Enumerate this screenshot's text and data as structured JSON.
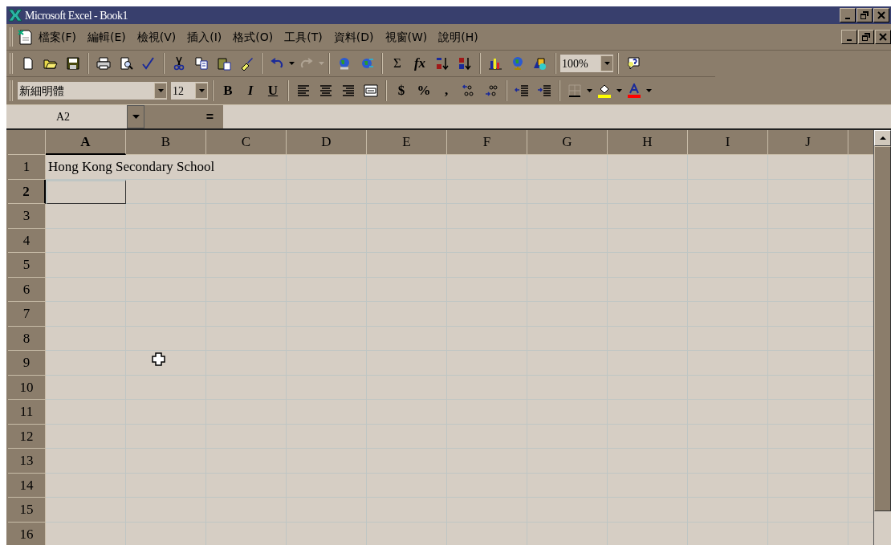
{
  "window": {
    "title": "Microsoft Excel - Book1"
  },
  "menu": [
    "檔案(F)",
    "編輯(E)",
    "檢視(V)",
    "插入(I)",
    "格式(O)",
    "工具(T)",
    "資料(D)",
    "視窗(W)",
    "說明(H)"
  ],
  "standard_toolbar": {
    "undo": {
      "disabled": false
    },
    "redo": {
      "disabled": true
    },
    "sum": "Σ",
    "function": "fx",
    "zoom": "100%"
  },
  "formatting_toolbar": {
    "font": "新細明體",
    "size": "12",
    "bold": "B",
    "italic": "I",
    "underline": "U",
    "currency": "$",
    "percent": "%",
    "comma": ","
  },
  "formula_bar": {
    "name_box": "A2",
    "equals": "="
  },
  "sheet": {
    "columns": [
      {
        "label": "A",
        "selected": true
      },
      {
        "label": "B",
        "selected": false
      },
      {
        "label": "C",
        "selected": false
      },
      {
        "label": "D",
        "selected": false
      },
      {
        "label": "E",
        "selected": false
      },
      {
        "label": "F",
        "selected": false
      },
      {
        "label": "G",
        "selected": false
      },
      {
        "label": "H",
        "selected": false
      },
      {
        "label": "I",
        "selected": false
      },
      {
        "label": "J",
        "selected": false
      }
    ],
    "rows": [
      {
        "label": "1",
        "selected": false,
        "cells": [
          {
            "text": "Hong Kong Secondary School",
            "selected": false
          },
          {
            "selected": false
          },
          {
            "selected": false
          },
          {
            "selected": false
          },
          {
            "selected": false
          },
          {
            "selected": false
          },
          {
            "selected": false
          },
          {
            "selected": false
          },
          {
            "selected": false
          },
          {
            "selected": false
          }
        ]
      },
      {
        "label": "2",
        "selected": true,
        "cells": [
          {
            "selected": true
          },
          {
            "selected": false
          },
          {
            "selected": false
          },
          {
            "selected": false
          },
          {
            "selected": false
          },
          {
            "selected": false
          },
          {
            "selected": false
          },
          {
            "selected": false
          },
          {
            "selected": false
          },
          {
            "selected": false
          }
        ]
      },
      {
        "label": "3",
        "selected": false,
        "cells": [
          {
            "selected": false
          },
          {
            "selected": false
          },
          {
            "selected": false
          },
          {
            "selected": false
          },
          {
            "selected": false
          },
          {
            "selected": false
          },
          {
            "selected": false
          },
          {
            "selected": false
          },
          {
            "selected": false
          },
          {
            "selected": false
          }
        ]
      },
      {
        "label": "4",
        "selected": false,
        "cells": [
          {
            "selected": false
          },
          {
            "selected": false
          },
          {
            "selected": false
          },
          {
            "selected": false
          },
          {
            "selected": false
          },
          {
            "selected": false
          },
          {
            "selected": false
          },
          {
            "selected": false
          },
          {
            "selected": false
          },
          {
            "selected": false
          }
        ]
      },
      {
        "label": "5",
        "selected": false,
        "cells": [
          {
            "selected": false
          },
          {
            "selected": false
          },
          {
            "selected": false
          },
          {
            "selected": false
          },
          {
            "selected": false
          },
          {
            "selected": false
          },
          {
            "selected": false
          },
          {
            "selected": false
          },
          {
            "selected": false
          },
          {
            "selected": false
          }
        ]
      },
      {
        "label": "6",
        "selected": false,
        "cells": [
          {
            "selected": false
          },
          {
            "selected": false
          },
          {
            "selected": false
          },
          {
            "selected": false
          },
          {
            "selected": false
          },
          {
            "selected": false
          },
          {
            "selected": false
          },
          {
            "selected": false
          },
          {
            "selected": false
          },
          {
            "selected": false
          }
        ]
      },
      {
        "label": "7",
        "selected": false,
        "cells": [
          {
            "selected": false
          },
          {
            "selected": false
          },
          {
            "selected": false
          },
          {
            "selected": false
          },
          {
            "selected": false
          },
          {
            "selected": false
          },
          {
            "selected": false
          },
          {
            "selected": false
          },
          {
            "selected": false
          },
          {
            "selected": false
          }
        ]
      },
      {
        "label": "8",
        "selected": false,
        "cells": [
          {
            "selected": false
          },
          {
            "selected": false
          },
          {
            "selected": false
          },
          {
            "selected": false
          },
          {
            "selected": false
          },
          {
            "selected": false
          },
          {
            "selected": false
          },
          {
            "selected": false
          },
          {
            "selected": false
          },
          {
            "selected": false
          }
        ]
      },
      {
        "label": "9",
        "selected": false,
        "cells": [
          {
            "selected": false
          },
          {
            "selected": false
          },
          {
            "selected": false
          },
          {
            "selected": false
          },
          {
            "selected": false
          },
          {
            "selected": false
          },
          {
            "selected": false
          },
          {
            "selected": false
          },
          {
            "selected": false
          },
          {
            "selected": false
          }
        ]
      },
      {
        "label": "10",
        "selected": false,
        "cells": [
          {
            "selected": false
          },
          {
            "selected": false
          },
          {
            "selected": false
          },
          {
            "selected": false
          },
          {
            "selected": false
          },
          {
            "selected": false
          },
          {
            "selected": false
          },
          {
            "selected": false
          },
          {
            "selected": false
          },
          {
            "selected": false
          }
        ]
      },
      {
        "label": "11",
        "selected": false,
        "cells": [
          {
            "selected": false
          },
          {
            "selected": false
          },
          {
            "selected": false
          },
          {
            "selected": false
          },
          {
            "selected": false
          },
          {
            "selected": false
          },
          {
            "selected": false
          },
          {
            "selected": false
          },
          {
            "selected": false
          },
          {
            "selected": false
          }
        ]
      },
      {
        "label": "12",
        "selected": false,
        "cells": [
          {
            "selected": false
          },
          {
            "selected": false
          },
          {
            "selected": false
          },
          {
            "selected": false
          },
          {
            "selected": false
          },
          {
            "selected": false
          },
          {
            "selected": false
          },
          {
            "selected": false
          },
          {
            "selected": false
          },
          {
            "selected": false
          }
        ]
      },
      {
        "label": "13",
        "selected": false,
        "cells": [
          {
            "selected": false
          },
          {
            "selected": false
          },
          {
            "selected": false
          },
          {
            "selected": false
          },
          {
            "selected": false
          },
          {
            "selected": false
          },
          {
            "selected": false
          },
          {
            "selected": false
          },
          {
            "selected": false
          },
          {
            "selected": false
          }
        ]
      },
      {
        "label": "14",
        "selected": false,
        "cells": [
          {
            "selected": false
          },
          {
            "selected": false
          },
          {
            "selected": false
          },
          {
            "selected": false
          },
          {
            "selected": false
          },
          {
            "selected": false
          },
          {
            "selected": false
          },
          {
            "selected": false
          },
          {
            "selected": false
          },
          {
            "selected": false
          }
        ]
      },
      {
        "label": "15",
        "selected": false,
        "cells": [
          {
            "selected": false
          },
          {
            "selected": false
          },
          {
            "selected": false
          },
          {
            "selected": false
          },
          {
            "selected": false
          },
          {
            "selected": false
          },
          {
            "selected": false
          },
          {
            "selected": false
          },
          {
            "selected": false
          },
          {
            "selected": false
          }
        ]
      },
      {
        "label": "16",
        "selected": false,
        "cells": [
          {
            "selected": false
          },
          {
            "selected": false
          },
          {
            "selected": false
          },
          {
            "selected": false
          },
          {
            "selected": false
          },
          {
            "selected": false
          },
          {
            "selected": false
          },
          {
            "selected": false
          },
          {
            "selected": false
          },
          {
            "selected": false
          }
        ]
      }
    ]
  }
}
